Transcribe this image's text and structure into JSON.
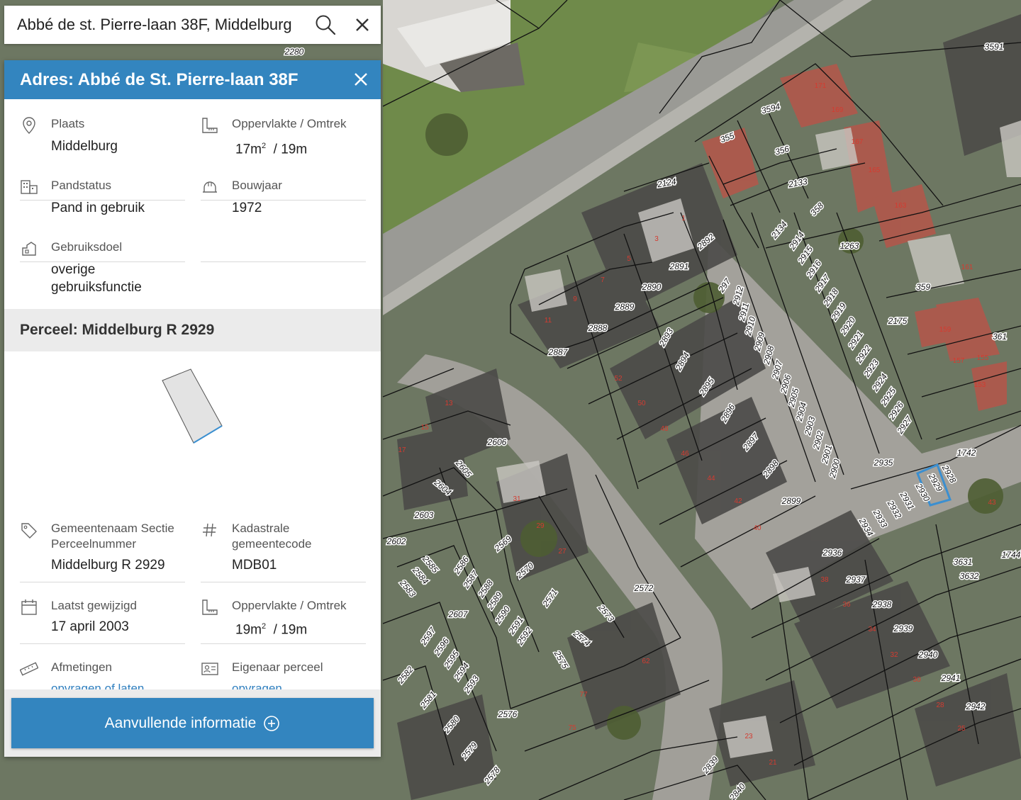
{
  "search": {
    "value": "Abbé de st. Pierre-laan 38F, Middelburg"
  },
  "panel": {
    "title": "Adres: Abbé de St. Pierre-laan 38F",
    "address_fields": [
      {
        "icon": "location-pin-icon",
        "label": "Plaats",
        "value": "Middelburg"
      },
      {
        "icon": "ruler-area-icon",
        "label": "Oppervlakte / Omtrek",
        "value_area": "17m",
        "value_sup": "2",
        "value_perimeter": "/ 19m"
      },
      {
        "icon": "building-status-icon",
        "label": "Pandstatus",
        "value": "Pand in gebruik"
      },
      {
        "icon": "construction-year-icon",
        "label": "Bouwjaar",
        "value": "1972"
      },
      {
        "icon": "usage-purpose-icon",
        "label": "Gebruiksdoel",
        "value": "overige gebruiksfunctie"
      }
    ],
    "parcel_section_title": "Perceel: Middelburg R 2929",
    "parcel_fields": [
      {
        "icon": "tag-icon",
        "label": "Gemeentenaam Sectie Perceelnummer",
        "value": "Middelburg R 2929"
      },
      {
        "icon": "hash-icon",
        "label": "Kadastrale gemeentecode",
        "value": "MDB01"
      },
      {
        "icon": "calendar-icon",
        "label": "Laatst gewijzigd",
        "value": "17 april 2003"
      },
      {
        "icon": "ruler-area-icon",
        "label": "Oppervlakte / Omtrek",
        "value_area": "19m",
        "value_sup": "2",
        "value_perimeter": "/ 19m"
      },
      {
        "icon": "measure-tape-icon",
        "label": "Afmetingen",
        "link": "opvragen of laten meten"
      },
      {
        "icon": "owner-card-icon",
        "label": "Eigenaar perceel",
        "link": "opvragen"
      }
    ],
    "cta_label": "Aanvullende informatie"
  },
  "map": {
    "parcel_labels": [
      "2280",
      "3594",
      "3591",
      "2124",
      "2133",
      "355",
      "356",
      "358",
      "2134",
      "2914",
      "2915",
      "2916",
      "2917",
      "2918",
      "2919",
      "2920",
      "2921",
      "2922",
      "2923",
      "2924",
      "2925",
      "2926",
      "2927",
      "1263",
      "359",
      "2175",
      "361",
      "2892",
      "2891",
      "2890",
      "2889",
      "2888",
      "2887",
      "2893",
      "2894",
      "2895",
      "2896",
      "2897",
      "2898",
      "2899",
      "297",
      "2912",
      "2911",
      "2910",
      "2909",
      "2908",
      "2907",
      "2906",
      "2905",
      "2904",
      "2903",
      "2902",
      "2901",
      "2900",
      "2935",
      "1742",
      "2929",
      "2928",
      "2930",
      "2931",
      "2932",
      "2933",
      "2934",
      "2936",
      "2937",
      "2938",
      "2939",
      "2940",
      "2941",
      "2942",
      "3631",
      "3632",
      "1744",
      "2606",
      "2605",
      "2604",
      "2603",
      "2602",
      "2569",
      "2570",
      "2571",
      "2572",
      "2573",
      "2574",
      "2575",
      "2576",
      "2577",
      "2578",
      "2579",
      "2580",
      "2581",
      "2582",
      "2583",
      "2584",
      "2585",
      "2586",
      "2587",
      "2588",
      "2589",
      "2590",
      "2591",
      "2592",
      "2593",
      "2594",
      "2595",
      "2596",
      "2597",
      "2607",
      "2839",
      "2840"
    ],
    "house_numbers": [
      "1",
      "3",
      "5",
      "7",
      "9",
      "11",
      "13",
      "15",
      "17",
      "21",
      "23",
      "25",
      "27",
      "28",
      "29",
      "30",
      "31",
      "32",
      "34",
      "36",
      "38",
      "40",
      "42",
      "44",
      "46",
      "48",
      "50",
      "52",
      "62",
      "75",
      "77",
      "153",
      "155",
      "157",
      "159",
      "161",
      "163",
      "165",
      "167",
      "169",
      "171",
      "43"
    ]
  }
}
